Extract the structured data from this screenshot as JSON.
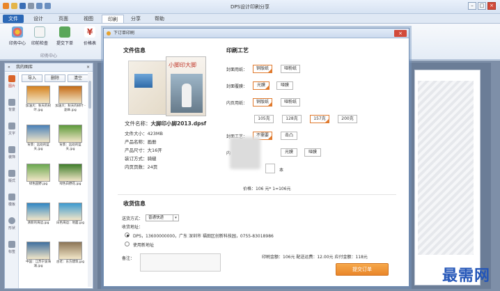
{
  "app": {
    "title": "DPS设计印刷分享"
  },
  "menu": [
    {
      "label": "文件"
    },
    {
      "label": "设计"
    },
    {
      "label": "页面"
    },
    {
      "label": "视图"
    },
    {
      "label": "印刷"
    },
    {
      "label": "分享"
    },
    {
      "label": "帮助"
    }
  ],
  "ribbon": {
    "buttons": [
      {
        "label": "印务中心"
      },
      {
        "label": "印前检查"
      },
      {
        "label": "提交下单"
      },
      {
        "label": "价格表"
      }
    ],
    "group_label": "印务中心"
  },
  "left_panel": {
    "title": "我的图库",
    "buttons": [
      "导入",
      "删除",
      "清空"
    ],
    "side_items": [
      "图片",
      "背景",
      "文字",
      "装饰",
      "版式",
      "模板",
      "形状",
      "标签"
    ],
    "thumbs": [
      {
        "caption": "加油大：秋天的树叶.jpg",
        "color": "#d6821e"
      },
      {
        "caption": "加油大：秋天的树叶 - 副本.jpg",
        "color": "#c56a14"
      },
      {
        "caption": "背景：远处的蓝天.jpg",
        "color": "#4a80b8"
      },
      {
        "caption": "背景：远处的蓝天.jpg",
        "color": "#5d9a3a"
      },
      {
        "caption": "绿色田野.jpg",
        "color": "#6aa84f"
      },
      {
        "caption": "绿色白野花.jpg",
        "color": "#3f7d2a"
      },
      {
        "caption": "清新的海边.jpg",
        "color": "#2f86c4"
      },
      {
        "caption": "白色海边：地面.jpg",
        "color": "#3c9ad0"
      },
      {
        "caption": "中国：江苏宁波海滩.jpg",
        "color": "#3f6f9f"
      },
      {
        "caption": "古老：东方建筑.jpg",
        "color": "#8c7556"
      }
    ]
  },
  "dialog": {
    "title": "下订单印刷",
    "close": "×",
    "file_info_title": "文件信息",
    "cover_title": "小脚印大脚",
    "file_name_label": "文件名称：",
    "file_name": "大脚印小脚2013.dpsf",
    "file_size": "文件大小：423MB",
    "product_name": "产品名称：画册",
    "product_size": "产品尺寸：大16开",
    "binding": "装订方式：骑缝",
    "pages": "内页页数：24页",
    "print_title": "印刷工艺",
    "cover_paper_label": "封面用纸：",
    "cover_paper": [
      "铜版纸",
      "哑粉纸"
    ],
    "cover_coating_label": "封面覆膜：",
    "cover_coating": [
      "光膜",
      "哑膜"
    ],
    "inner_paper_label": "内页用纸：",
    "inner_paper": [
      "铜版纸",
      "哑粉纸"
    ],
    "weights": [
      "105克",
      "128克",
      "157克",
      "200克"
    ],
    "cover_craft_label": "封面工艺：",
    "cover_craft": [
      "不需要",
      "击凸"
    ],
    "inner_craft_label": "内",
    "inner_craft": [
      "光膜",
      "哑膜"
    ],
    "qty_unit": "本",
    "price": "价格：106 元* 1=106元",
    "ship_title": "收货信息",
    "delivery_label": "送货方式：",
    "delivery_value": "普通快递",
    "address_label": "收货地址：",
    "address_value": "DPS，13600000000，广东 深圳市 福田区创新科技园，0755-83018986",
    "new_address": "使用新地址",
    "note_label": "备注：",
    "totals": "印刷金额：106元  配送运费：12.00元  应付金额：118元",
    "submit": "提交订单"
  },
  "watermark": "最需网",
  "colors": {
    "accent": "#2b68b6",
    "orange": "#e9862a",
    "close": "#d24a3a"
  }
}
